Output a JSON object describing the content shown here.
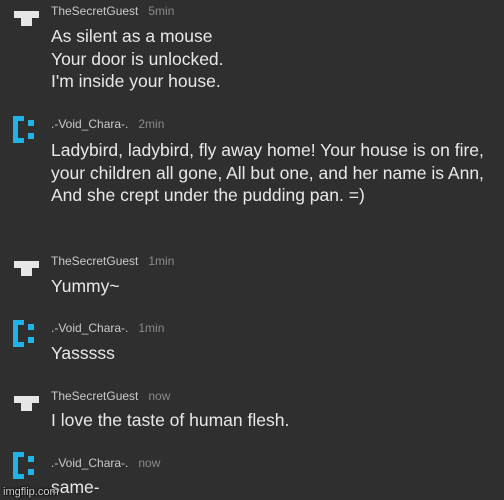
{
  "messages": [
    {
      "user": "TheSecretGuest",
      "time": "5min",
      "avatar": "gray-tee-avatar-icon",
      "text": "As silent as a mouse\nYour door is unlocked.\nI'm inside your house."
    },
    {
      "user": ".-Void_Chara-.",
      "time": "2min",
      "avatar": "blue-bracket-avatar-icon",
      "text": "Ladybird, ladybird, fly away home! Your house is on fire, your children all gone, All but one, and her name is Ann, And she crept under the pudding pan. =)"
    },
    {
      "user": "TheSecretGuest",
      "time": "1min",
      "avatar": "gray-tee-avatar-icon",
      "text": "Yummy~"
    },
    {
      "user": ".-Void_Chara-.",
      "time": "1min",
      "avatar": "blue-bracket-avatar-icon",
      "text": "Yasssss"
    },
    {
      "user": "TheSecretGuest",
      "time": "now",
      "avatar": "gray-tee-avatar-icon",
      "text": "I love the taste of human flesh."
    },
    {
      "user": ".-Void_Chara-.",
      "time": "now",
      "avatar": "blue-bracket-avatar-icon",
      "text": "same-"
    }
  ],
  "watermark": "imgflip.com",
  "colors": {
    "background": "#2f2f2f",
    "avatar_gray": "#e6e6e6",
    "avatar_blue": "#1fb3e8",
    "username": "#c9c9c9",
    "time": "#8a8a8a",
    "text": "#e8e8e8"
  }
}
